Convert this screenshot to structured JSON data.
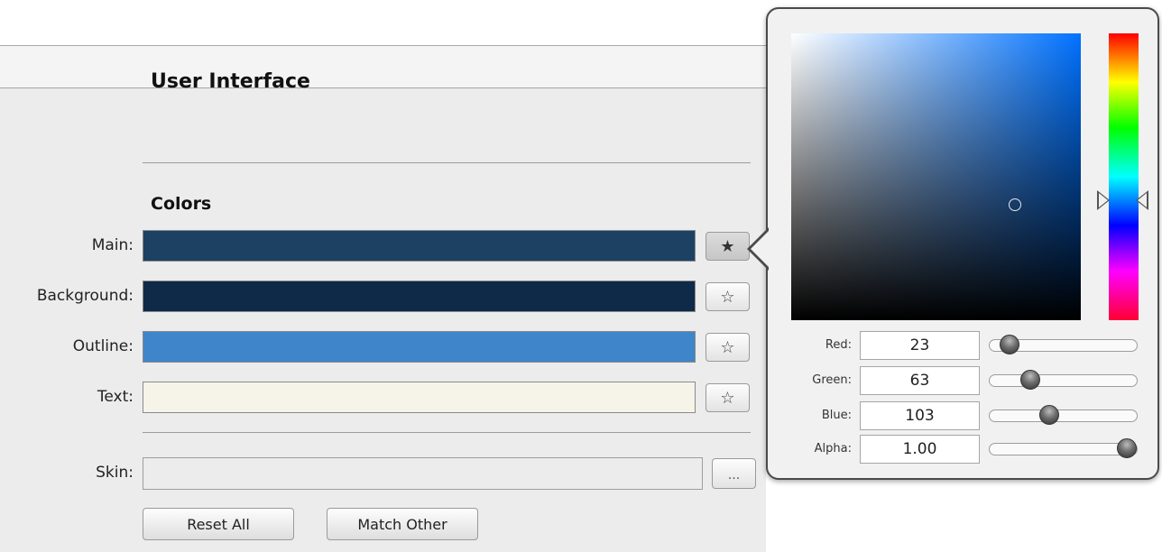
{
  "section": {
    "title": "User Interface",
    "colors_heading": "Colors"
  },
  "colors": [
    {
      "label": "Main:",
      "swatch": "#1c4163",
      "star": "★",
      "active": true
    },
    {
      "label": "Background:",
      "swatch": "#0e2a48",
      "star": "☆",
      "active": false
    },
    {
      "label": "Outline:",
      "swatch": "#3e86c9",
      "star": "☆",
      "active": false
    },
    {
      "label": "Text:",
      "swatch": "#f6f3e8",
      "star": "☆",
      "active": false
    }
  ],
  "skin": {
    "label": "Skin:",
    "value": "",
    "browse_label": "..."
  },
  "buttons": {
    "reset_all": "Reset All",
    "match_other": "Match Other"
  },
  "picker": {
    "channels": [
      {
        "label": "Red:",
        "value": "23",
        "level": 0.09
      },
      {
        "label": "Green:",
        "value": "63",
        "level": 0.25
      },
      {
        "label": "Blue:",
        "value": "103",
        "level": 0.4
      },
      {
        "label": "Alpha:",
        "value": "1.00",
        "level": 1.0
      }
    ]
  },
  "icons": {
    "star_filled": "star-filled-icon",
    "star_outline": "star-outline-icon"
  }
}
